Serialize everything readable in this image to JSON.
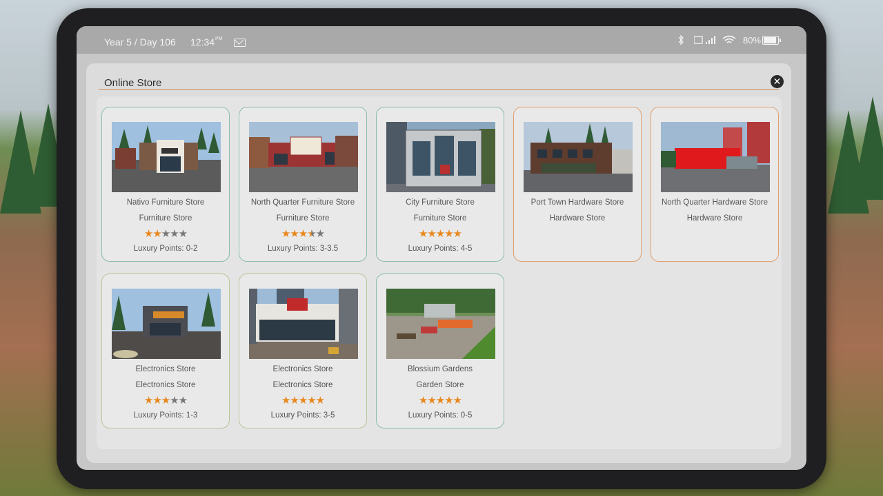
{
  "status_bar": {
    "date": "Year 5 / Day 106",
    "time": "12:34",
    "time_suffix": "PM",
    "battery": "80%",
    "battery_level": 0.8
  },
  "window": {
    "title": "Online Store"
  },
  "stores": [
    {
      "name": "Nativo Furniture Store",
      "category": "Furniture Store",
      "rating": 2,
      "max_rating": 5,
      "luxury": "Luxury Points: 0-2",
      "accent": "green",
      "image": "furniture-storefront-1"
    },
    {
      "name": "North Quarter Furniture Store",
      "category": "Furniture Store",
      "rating": 3.5,
      "max_rating": 5,
      "luxury": "Luxury Points: 3-3.5",
      "accent": "green",
      "image": "furniture-storefront-2"
    },
    {
      "name": "City Furniture Store",
      "category": "Furniture Store",
      "rating": 5,
      "max_rating": 5,
      "luxury": "Luxury Points: 4-5",
      "accent": "green",
      "image": "furniture-storefront-3"
    },
    {
      "name": "Port Town Hardware Store",
      "category": "Hardware Store",
      "accent": "orange",
      "image": "hardware-storefront-1"
    },
    {
      "name": "North Quarter Hardware Store",
      "category": "Hardware Store",
      "accent": "orange",
      "image": "hardware-storefront-2"
    },
    {
      "name": "Electronics Store",
      "category": "Electronics Store",
      "rating": 3,
      "max_rating": 5,
      "luxury": "Luxury Points: 1-3",
      "accent": "olive",
      "image": "electronics-storefront-1"
    },
    {
      "name": "Electronics Store",
      "category": "Electronics Store",
      "rating": 5,
      "max_rating": 5,
      "luxury": "Luxury Points: 3-5",
      "accent": "olive",
      "image": "electronics-storefront-2"
    },
    {
      "name": "Blossium Gardens",
      "category": "Garden Store",
      "rating": 5,
      "max_rating": 5,
      "luxury": "Luxury Points: 0-5",
      "accent": "green",
      "image": "garden-store-1"
    }
  ],
  "colors": {
    "star_on": "#e8871c",
    "star_off": "#777777",
    "accent_green": "#8cbda7",
    "accent_orange": "#e0a070",
    "accent_olive": "#b6c79a",
    "title_rule": "#d28d55"
  },
  "icons": {
    "status": [
      "bluetooth-icon",
      "signal-icon",
      "wifi-icon",
      "battery-icon"
    ],
    "mail": "mail-icon",
    "close": "close-icon",
    "star": "star-icon"
  }
}
